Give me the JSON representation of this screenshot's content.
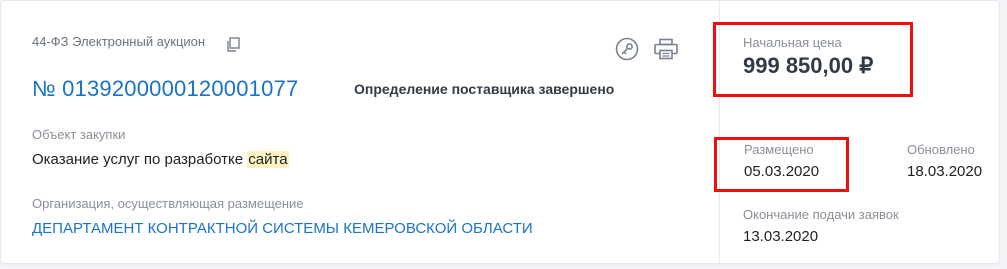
{
  "card": {
    "law_type": "44-ФЗ Электронный аукцион",
    "number": "№ 0139200000120001077",
    "status": "Определение поставщика завершено",
    "object": {
      "label": "Объект закупки",
      "value_prefix": "Оказание услуг по разработке ",
      "value_highlight": "сайта"
    },
    "organization": {
      "label": "Организация, осуществляющая размещение",
      "value": "ДЕПАРТАМЕНТ КОНТРАКТНОЙ СИСТЕМЫ КЕМЕРОВСКОЙ ОБЛАСТИ"
    }
  },
  "side": {
    "price_label": "Начальная цена",
    "price_value": "999 850,00 ₽",
    "placed_label": "Размещено",
    "placed_value": "05.03.2020",
    "updated_label": "Обновлено",
    "updated_value": "18.03.2020",
    "deadline_label": "Окончание подачи заявок",
    "deadline_value": "13.03.2020"
  },
  "icons": {
    "copy": "copy-icon",
    "key": "key-icon",
    "print": "printer-icon"
  },
  "colors": {
    "link": "#1a73c8",
    "highlight": "#fdf3c2",
    "annotation_red": "#f20d0d"
  }
}
